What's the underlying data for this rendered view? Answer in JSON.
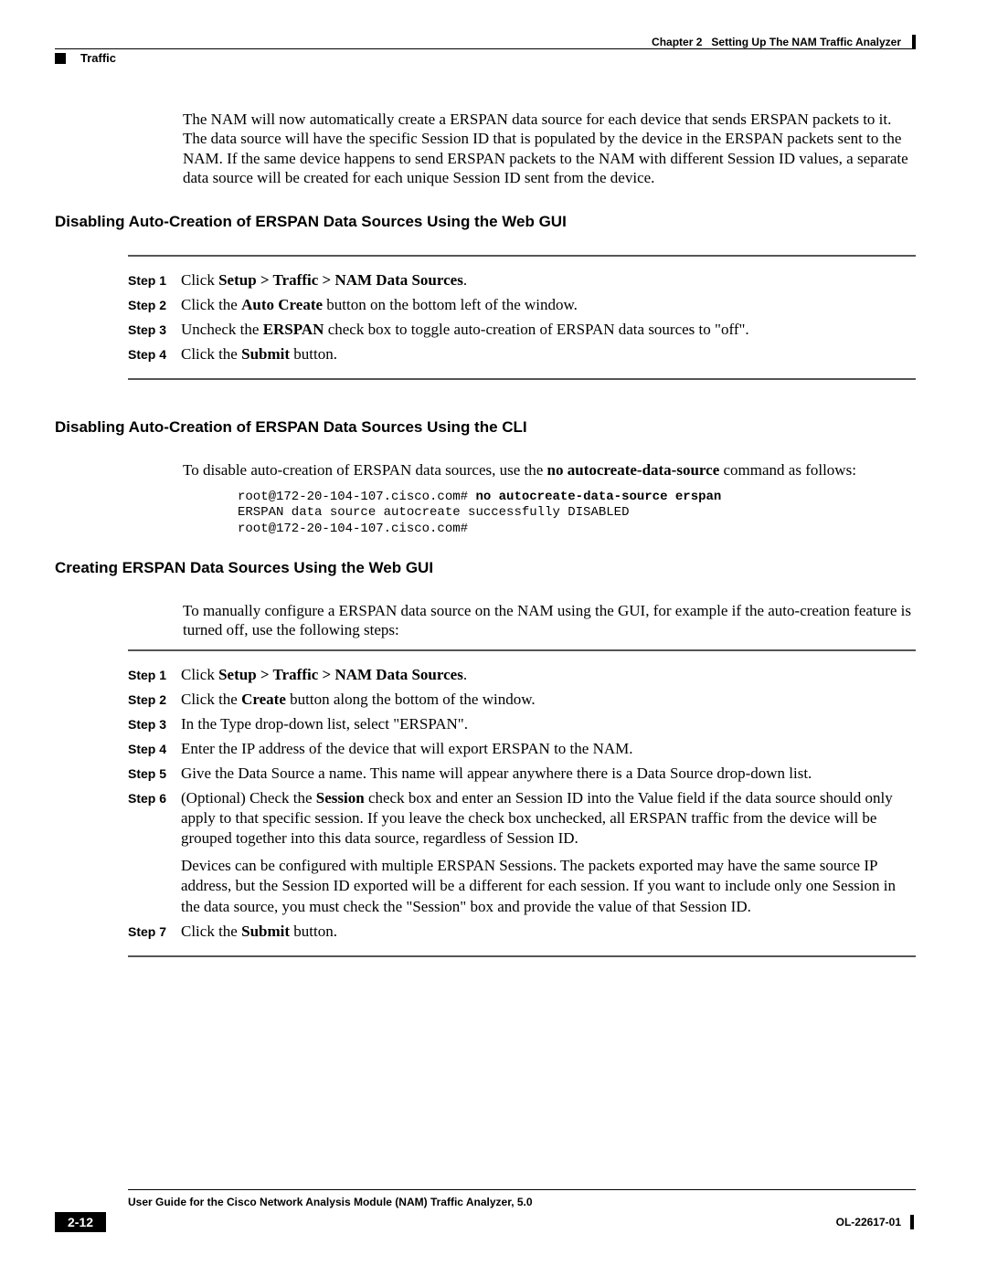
{
  "header": {
    "chapter_label": "Chapter 2",
    "chapter_title": "Setting Up The NAM Traffic Analyzer",
    "section": "Traffic"
  },
  "intro": {
    "text": "The NAM will now automatically create a ERSPAN data source for each device that sends ERSPAN packets to it.  The data source will have the specific Session ID that is populated by the device in the ERSPAN packets sent to the NAM.  If the same device happens to send ERSPAN packets to the NAM with different Session ID values, a separate data source will be created for each unique Session ID sent from the device."
  },
  "section1": {
    "heading": "Disabling Auto-Creation of ERSPAN Data Sources Using the Web GUI",
    "steps": [
      {
        "label": "Step 1",
        "pre": "Click ",
        "bold": "Setup > Traffic > NAM Data Sources",
        "post": "."
      },
      {
        "label": "Step 2",
        "pre": "Click the ",
        "bold": "Auto Create",
        "post": " button on the bottom left of the window."
      },
      {
        "label": "Step 3",
        "pre": "Uncheck the ",
        "bold": "ERSPAN",
        "post": " check box to toggle auto-creation of ERSPAN data sources to \"off\"."
      },
      {
        "label": "Step 4",
        "pre": "Click the ",
        "bold": "Submit",
        "post": " button."
      }
    ]
  },
  "section2": {
    "heading": "Disabling Auto-Creation of ERSPAN Data Sources Using the CLI",
    "para_pre": "To disable auto-creation of ERSPAN data sources, use the ",
    "para_bold": "no autocreate-data-source",
    "para_post": " command as follows:",
    "code_prompt": "root@172-20-104-107.cisco.com# ",
    "code_cmd": "no autocreate-data-source erspan",
    "code_line2": "ERSPAN data source autocreate successfully DISABLED",
    "code_line3": "root@172-20-104-107.cisco.com#"
  },
  "section3": {
    "heading": "Creating ERSPAN Data Sources Using the Web GUI",
    "intro": "To manually configure a ERSPAN data source on the NAM using the GUI, for example if the auto-creation feature is turned off, use the following steps:",
    "steps": [
      {
        "label": "Step 1",
        "pre": "Click ",
        "bold": "Setup > Traffic > NAM Data Sources",
        "post": "."
      },
      {
        "label": "Step 2",
        "pre": "Click the ",
        "bold": "Create",
        "post": " button along the bottom of the window."
      },
      {
        "label": "Step 3",
        "pre": "In the Type drop-down list, select \"ERSPAN\".",
        "bold": "",
        "post": ""
      },
      {
        "label": "Step 4",
        "pre": "Enter the IP address of the device that will export ERSPAN to the NAM.",
        "bold": "",
        "post": ""
      },
      {
        "label": "Step 5",
        "pre": "Give the Data Source a name. This name will appear anywhere there is a Data Source drop-down list.",
        "bold": "",
        "post": ""
      },
      {
        "label": "Step 6",
        "pre": "(Optional) Check the ",
        "bold": "Session",
        "post": " check box and enter an Session ID into the Value field if the data source should only apply to that specific session. If you leave the check box unchecked, all ERSPAN traffic from the device will be grouped together into this data source, regardless of Session ID.",
        "extra": "Devices can be configured with multiple ERSPAN Sessions.   The packets exported may have the same source IP address, but the Session ID exported will be a different for each session. If you want to include only one Session in the data source, you must check the \"Session\" box and provide the value of that Session ID."
      },
      {
        "label": "Step 7",
        "pre": "Click the ",
        "bold": "Submit",
        "post": " button."
      }
    ]
  },
  "footer": {
    "title": "User Guide for the Cisco Network Analysis Module (NAM) Traffic Analyzer, 5.0",
    "page": "2-12",
    "docid": "OL-22617-01"
  }
}
